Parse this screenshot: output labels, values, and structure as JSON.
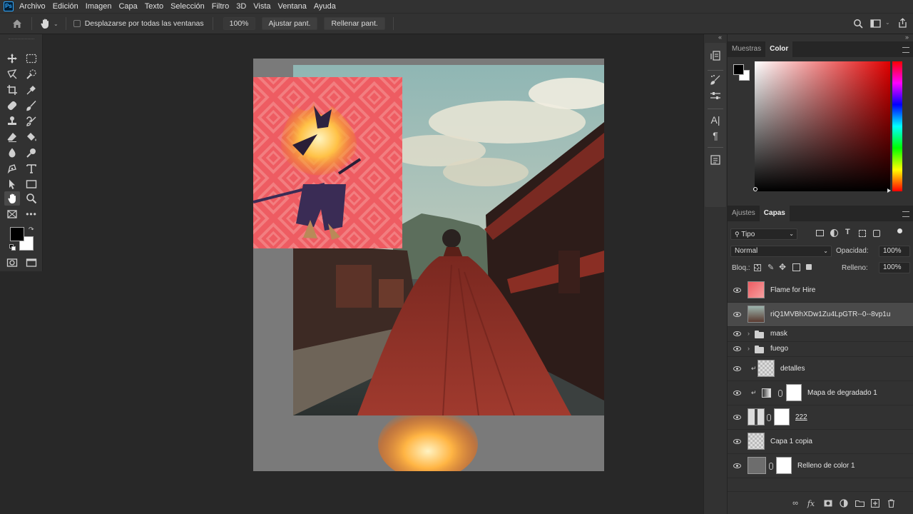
{
  "app": {
    "logo": "Ps"
  },
  "menu": [
    "Archivo",
    "Edición",
    "Imagen",
    "Capa",
    "Texto",
    "Selección",
    "Filtro",
    "3D",
    "Vista",
    "Ventana",
    "Ayuda"
  ],
  "options": {
    "scroll_all_label": "Desplazarse por todas las ventanas",
    "zoom_value": "100%",
    "fit_screen_label": "Ajustar pant.",
    "fill_screen_label": "Rellenar pant."
  },
  "color_panel": {
    "tabs": [
      "Muestras",
      "Color"
    ],
    "active_tab": "Color",
    "foreground": "#000000",
    "background": "#ffffff",
    "hue_color": "#e00000"
  },
  "layers_panel": {
    "tabs": [
      "Ajustes",
      "Capas"
    ],
    "active_tab": "Capas",
    "filter_label": "Tipo",
    "blend_mode": "Normal",
    "opacity_label": "Opacidad:",
    "opacity_value": "100%",
    "lock_label": "Bloq.:",
    "fill_label": "Relleno:",
    "fill_value": "100%",
    "layers": [
      {
        "name": "Flame for Hire",
        "type": "smart-object",
        "selected": false
      },
      {
        "name": "riQ1MVBhXDw1Zu4LpGTR--0--8vp1u",
        "type": "smart-object",
        "selected": true
      },
      {
        "name": "mask",
        "type": "group",
        "selected": false
      },
      {
        "name": "fuego",
        "type": "group",
        "selected": false
      },
      {
        "name": "detalles",
        "type": "clipped-layer",
        "selected": false
      },
      {
        "name": "Mapa de degradado 1",
        "type": "adjustment",
        "selected": false
      },
      {
        "name": "222",
        "type": "masked-layer",
        "selected": false
      },
      {
        "name": "Capa 1 copia",
        "type": "layer",
        "selected": false
      },
      {
        "name": "Relleno de color 1",
        "type": "fill",
        "selected": false
      }
    ]
  }
}
